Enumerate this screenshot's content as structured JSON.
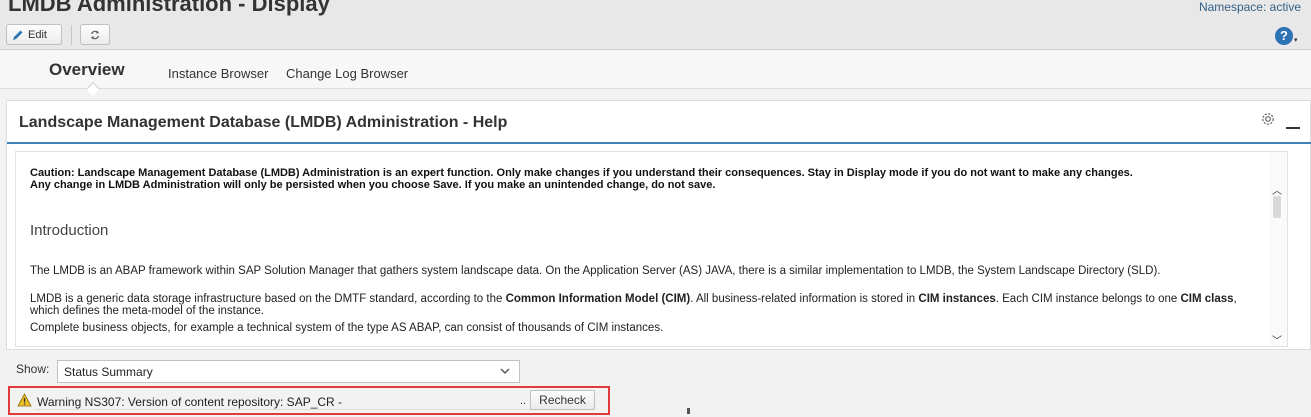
{
  "header": {
    "title": "LMDB Administration - Display",
    "namespace": "Namespace: active",
    "edit_label": "Edit"
  },
  "tabs": [
    {
      "label": "Overview",
      "selected": true
    },
    {
      "label": "Instance Browser",
      "selected": false
    },
    {
      "label": "Change Log Browser",
      "selected": false
    }
  ],
  "panel": {
    "title": "Landscape Management Database (LMDB) Administration - Help",
    "caution_line1": "Caution: Landscape Management Database (LMDB) Administration is an expert function. Only make changes if you understand their consequences. Stay in Display mode if you do not want to make any changes.",
    "caution_line2": "Any change in LMDB Administration will only be persisted when you choose Save. If you make an unintended change, do not save.",
    "intro_title": "Introduction",
    "para1": "The LMDB is an ABAP framework within SAP Solution Manager that gathers system landscape data. On the Application Server (AS) JAVA, there is a similar implementation to LMDB, the System Landscape Directory (SLD).",
    "para2_a": "LMDB is a generic data storage infrastructure based on the DMTF standard, according to the ",
    "para2_b": "Common Information Model (CIM)",
    "para2_c": ". All business-related information is stored in ",
    "para2_d": "CIM instances",
    "para2_e": ". Each CIM instance belongs to one ",
    "para2_f": "CIM class",
    "para2_g": ", which defines the meta-model of the instance.",
    "para3": "Complete business objects, for example a technical system of the type AS ABAP, can consist of thousands of CIM instances."
  },
  "show": {
    "label": "Show:",
    "selected": "Status Summary"
  },
  "warning": {
    "text": "Warning NS307: Version of content repository: SAP_CR -",
    "ellipsis": "..",
    "recheck_label": "Recheck"
  },
  "colors": {
    "accent": "#3e83b8",
    "highlight_frame": "#e23a3a",
    "warning_icon": "#f0c02a"
  }
}
